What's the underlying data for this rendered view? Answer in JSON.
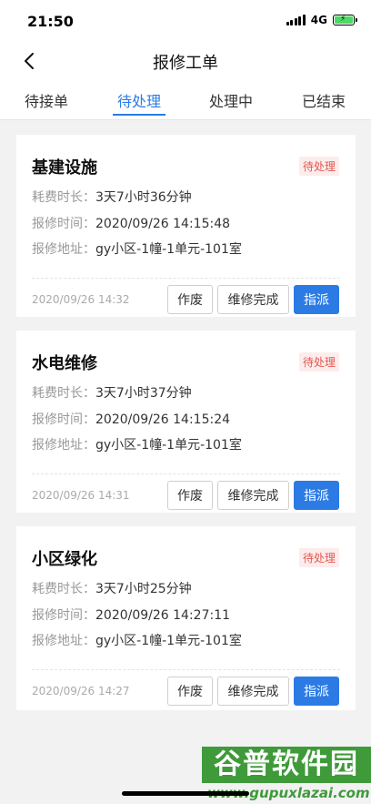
{
  "status_bar": {
    "time": "21:50",
    "network": "4G",
    "battery_level": 1.0,
    "battery_color": "#4cd964"
  },
  "header": {
    "back_icon": "chevron-left-icon",
    "title": "报修工单"
  },
  "tabs": [
    {
      "label": "待接单",
      "active": false
    },
    {
      "label": "待处理",
      "active": true
    },
    {
      "label": "处理中",
      "active": false
    },
    {
      "label": "已结束",
      "active": false
    }
  ],
  "labels": {
    "duration": "耗费时长：",
    "report_time": "报修时间：",
    "address": "报修地址："
  },
  "orders": [
    {
      "title": "基建设施",
      "status": "待处理",
      "duration": "3天7小时36分钟",
      "report_time": "2020/09/26 14:15:48",
      "address": "gy小区-1幢-1单元-101室",
      "timestamp": "2020/09/26 14:32",
      "buttons": {
        "void": "作废",
        "complete": "维修完成",
        "assign": "指派"
      }
    },
    {
      "title": "水电维修",
      "status": "待处理",
      "duration": "3天7小时37分钟",
      "report_time": "2020/09/26 14:15:24",
      "address": "gy小区-1幢-1单元-101室",
      "timestamp": "2020/09/26 14:31",
      "buttons": {
        "void": "作废",
        "complete": "维修完成",
        "assign": "指派"
      }
    },
    {
      "title": "小区绿化",
      "status": "待处理",
      "duration": "3天7小时25分钟",
      "report_time": "2020/09/26 14:27:11",
      "address": "gy小区-1幢-1单元-101室",
      "timestamp": "2020/09/26 14:27",
      "buttons": {
        "void": "作废",
        "complete": "维修完成",
        "assign": "指派"
      }
    }
  ],
  "watermark": {
    "brand": "谷普软件园",
    "url": "www.gupuxlazai.com"
  },
  "colors": {
    "accent": "#2c7be5",
    "status_badge": "#e4574f",
    "watermark": "#3f9a3a"
  }
}
